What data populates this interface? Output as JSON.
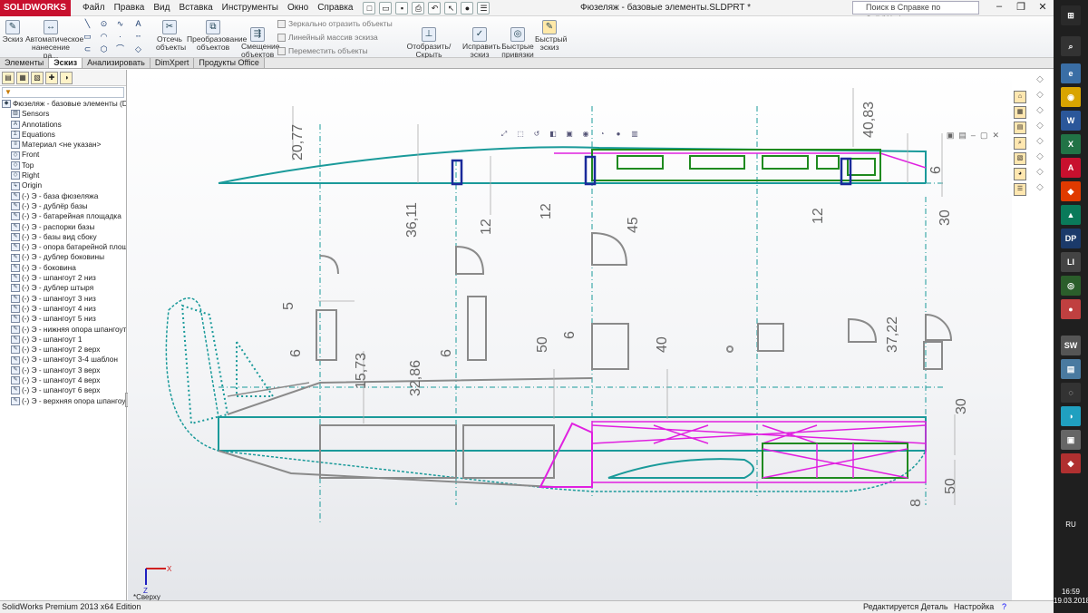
{
  "app": {
    "logo_text": "SOLIDWORKS",
    "document_title": "Фюзеляж - базовые элементы.SLDPRT *",
    "menu": [
      "Файл",
      "Правка",
      "Вид",
      "Вставка",
      "Инструменты",
      "Окно",
      "Справка"
    ],
    "search_placeholder": "Поиск в Справке по SolidWorks"
  },
  "toolbar": {
    "sketch_label": "Эскиз",
    "auto_dim_label": "Автоматическое нанесение ра...",
    "trim_label": "Отсечь объекты",
    "convert_label": "Преобразование объектов",
    "offset_label": "Смещение объектов",
    "mirror_label": "Зеркально отразить объекты",
    "linear_pattern_label": "Линейный массив эскиза",
    "move_label": "Переместить объекты",
    "display_relations_label": "Отобразить/Скрыть взаимосвязи",
    "repair_label": "Исправить эскиз",
    "quick_snaps_label": "Быстрые привязки",
    "rapid_sketch_label": "Быстрый эскиз"
  },
  "tabs": [
    "Элементы",
    "Эскиз",
    "Анализировать",
    "DimXpert",
    "Продукты Office"
  ],
  "active_tab": "Эскиз",
  "tree": {
    "root": "Фюзеляж - базовые элементы  (Defa",
    "items": [
      "Sensors",
      "Annotations",
      "Equations",
      "Материал <не указан>",
      "Front",
      "Top",
      "Right",
      "Origin",
      "(-) Э - база фюзеляжа",
      "(-) Э - дублёр базы",
      "(-) Э - батарейная площадка",
      "(-) Э - распорки базы",
      "(-) Э - базы вид сбоку",
      "(-) Э - опора батарейной площа,",
      "(-) Э - дублер боковины",
      "(-) Э - боковина",
      "(-) Э - шпангоут 2 низ",
      "(-) Э - дублер штыря",
      "(-) Э - шпангоут 3 низ",
      "(-) Э - шпангоут 4 низ",
      "(-) Э - шпангоут 5 низ",
      "(-) Э - нижняя опора шпангоутс",
      "(-) Э - шпангоут 1",
      "(-) Э - шпангоут 2 верх",
      "(-) Э - шпангоут 3-4 шаблон",
      "(-) Э - шпангоут 3 верх",
      "(-) Э - шпангоут 4 верх",
      "(-) Э - шпангоут 6 верх",
      "(-) Э - верхняя опора шпангоуто"
    ]
  },
  "dimensions": [
    "20,77",
    "40,83",
    "36,11",
    "12",
    "12",
    "45",
    "12",
    "6",
    "30",
    "5",
    "6",
    "15,73",
    "32,86",
    "6",
    "50",
    "6",
    "40",
    "37,22",
    "30",
    "8",
    "50"
  ],
  "view_label": "*Сверху",
  "axis_x": "X",
  "axis_z": "Z",
  "status": {
    "edition": "SolidWorks Premium 2013 x64 Edition",
    "state": "Редактируется Деталь",
    "settings": "Настройка",
    "help": "?"
  },
  "taskbar": {
    "lang": "RU",
    "time": "16:59",
    "date": "19.03.2018"
  },
  "colors": {
    "teal": "#1a9a9a",
    "cyan": "#00c8c8",
    "green": "#1f8a1f",
    "magenta": "#e020e0",
    "navy": "#1a2a9a",
    "gray": "#8a8a8a"
  }
}
